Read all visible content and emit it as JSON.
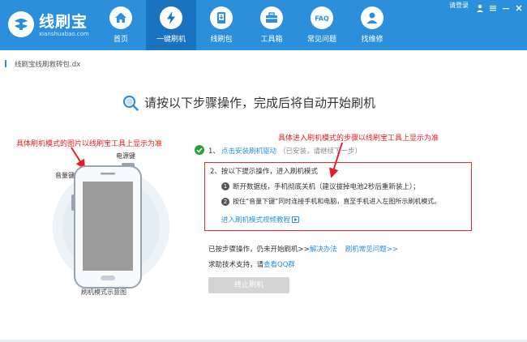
{
  "app": {
    "title": "线刷宝",
    "subtitle": "xianshuabao.com"
  },
  "window": {
    "login_label": "请登录"
  },
  "nav": {
    "items": [
      {
        "label": "首页",
        "icon": "home-icon",
        "active": false
      },
      {
        "label": "一键刷机",
        "icon": "flash-icon",
        "active": true
      },
      {
        "label": "线刷包",
        "icon": "package-icon",
        "active": false
      },
      {
        "label": "工具箱",
        "icon": "toolbox-icon",
        "active": false
      },
      {
        "label": "常见问题",
        "icon": "faq-icon",
        "active": false
      },
      {
        "label": "找维修",
        "icon": "repair-icon",
        "active": false
      }
    ]
  },
  "breadcrumb": {
    "text": "线刷宝线刷救砖包.dx"
  },
  "main": {
    "title": "请按以下步骤操作，完成后将自动开始刷机",
    "note_left": "具体刷机模式的图片以线刷宝工具上显示为准",
    "note_right": "具体进入刷机模式的步骤以线刷宝工具上显示为准",
    "phone": {
      "power_key_label": "电源键",
      "volume_key_label": "音量键",
      "caption": "刷机模式示意图"
    },
    "step1": {
      "number": "1、",
      "link": "点击安装刷机驱动",
      "hint": "（已安装，请继续下一步）"
    },
    "step2": {
      "title": "2、按以下提示操作，进入刷机模式",
      "items": [
        {
          "num": "1",
          "text": "断开数据线，手机彻底关机（建议拔掉电池2秒后重新装上）；"
        },
        {
          "num": "2",
          "text": "按住“音量下键”同时连接手机和电脑，直至手机进入左图所示刷机模式。"
        }
      ],
      "video_link": "进入刷机模式视频教程"
    },
    "help": {
      "not_started": "已按步骤操作，仍未开始刷机>>",
      "solution_link": "解决办法",
      "faq_link": "刷机常见问题>>",
      "support_prefix": "求助技术支持，请",
      "qq_link": "查看QQ群"
    },
    "stop_button": "终止刷机"
  },
  "colors": {
    "header": "#2b8fdb",
    "active_tab": "#1a73bf",
    "link": "#2b8fdb",
    "note_red": "#e61e1e",
    "check_green": "#21a33a"
  }
}
